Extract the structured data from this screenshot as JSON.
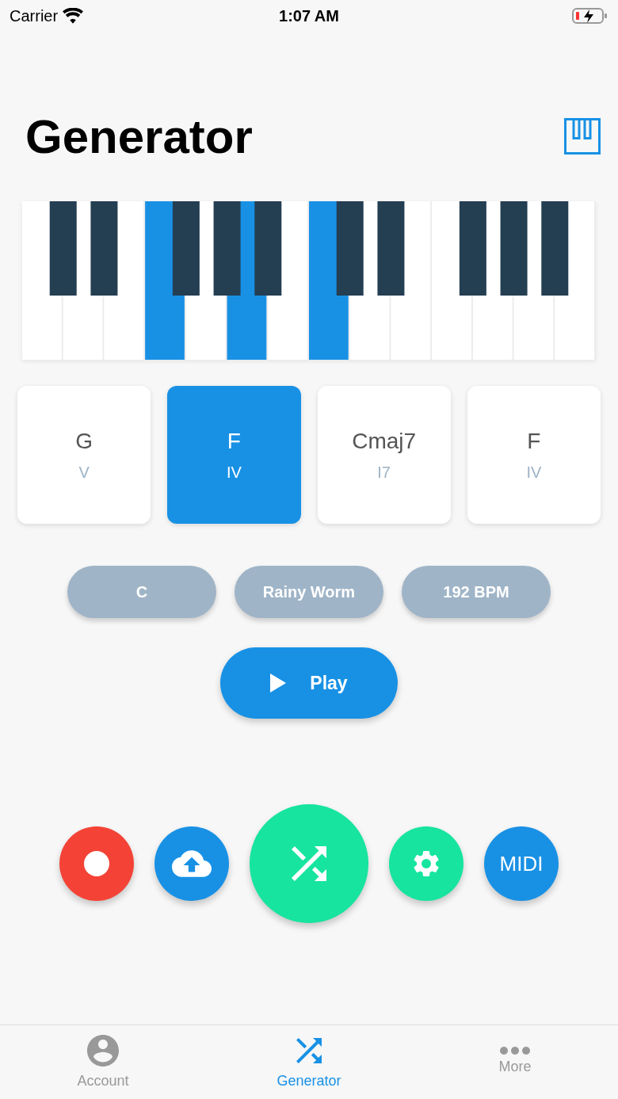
{
  "status_bar": {
    "carrier": "Carrier",
    "time": "1:07 AM",
    "charging": true
  },
  "title": "Generator",
  "piano": {
    "white_keys": [
      {
        "selected": false,
        "sharp": {
          "selected": false
        }
      },
      {
        "selected": false,
        "sharp": {
          "selected": false
        }
      },
      {
        "selected": false
      },
      {
        "selected": true,
        "sharp": {
          "selected": false
        }
      },
      {
        "selected": false,
        "sharp": {
          "selected": false
        }
      },
      {
        "selected": true,
        "sharp": {
          "selected": false
        }
      },
      {
        "selected": false
      },
      {
        "selected": true,
        "sharp": {
          "selected": false
        }
      },
      {
        "selected": false,
        "sharp": {
          "selected": false
        }
      },
      {
        "selected": false
      },
      {
        "selected": false,
        "sharp": {
          "selected": false
        }
      },
      {
        "selected": false,
        "sharp": {
          "selected": false
        }
      },
      {
        "selected": false,
        "sharp": {
          "selected": false
        }
      },
      {
        "selected": false
      }
    ]
  },
  "chords": [
    {
      "name": "G",
      "numeral": "V",
      "selected": false
    },
    {
      "name": "F",
      "numeral": "IV",
      "selected": true
    },
    {
      "name": "Cmaj7",
      "numeral": "I7",
      "selected": false
    },
    {
      "name": "F",
      "numeral": "IV",
      "selected": false
    }
  ],
  "options": [
    "C",
    "Rainy Worm",
    "192 BPM"
  ],
  "play_button": {
    "label": "Play"
  },
  "actions": [
    {
      "kind": "record"
    },
    {
      "kind": "upload"
    },
    {
      "kind": "shuffle"
    },
    {
      "kind": "settings"
    },
    {
      "kind": "midi",
      "label": "MIDI"
    }
  ],
  "tab_bar": [
    {
      "kind": "account",
      "label": "Account",
      "selected": false
    },
    {
      "kind": "shuffle",
      "label": "Generator",
      "selected": true
    },
    {
      "kind": "more",
      "label": "More",
      "selected": false
    }
  ]
}
